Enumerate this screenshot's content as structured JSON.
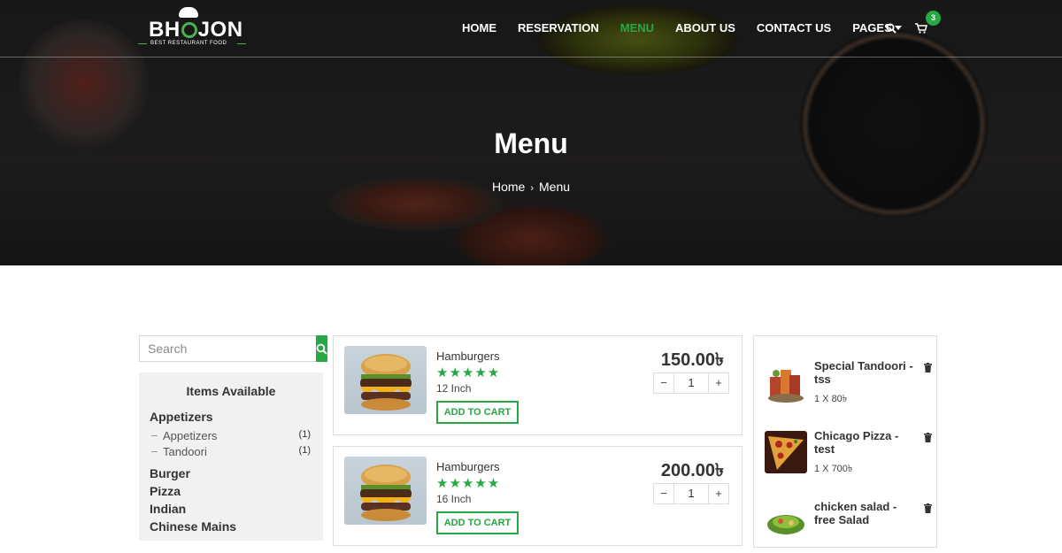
{
  "brand": {
    "name_left": "BH",
    "name_right": "JON",
    "tagline": "BEST RESTAURANT FOOD"
  },
  "nav": {
    "items": [
      {
        "label": "HOME"
      },
      {
        "label": "RESERVATION"
      },
      {
        "label": "MENU"
      },
      {
        "label": "ABOUT US"
      },
      {
        "label": "CONTACT US"
      },
      {
        "label": "PAGES"
      }
    ],
    "cart_count": "3"
  },
  "hero": {
    "title": "Menu",
    "breadcrumb": {
      "home": "Home",
      "separator": "›",
      "current": "Menu"
    }
  },
  "search": {
    "placeholder": "Search"
  },
  "categories": {
    "heading": "Items Available",
    "group_appetizers": "Appetizers",
    "sub": [
      {
        "label": "Appetizers",
        "count": "(1)"
      },
      {
        "label": "Tandoori",
        "count": "(1)"
      }
    ],
    "others": [
      {
        "label": "Burger"
      },
      {
        "label": "Pizza"
      },
      {
        "label": "Indian"
      },
      {
        "label": "Chinese Mains"
      }
    ]
  },
  "products": [
    {
      "name": "Hamburgers",
      "stars": "★★★★★",
      "rating": 5,
      "size": "12 Inch",
      "price": "150.00৳",
      "qty": "1",
      "button": "ADD TO CART"
    },
    {
      "name": "Hamburgers",
      "stars": "★★★★★",
      "rating": 5,
      "size": "16 Inch",
      "price": "200.00৳",
      "qty": "1",
      "button": "ADD TO CART"
    }
  ],
  "cart": {
    "items": [
      {
        "title": "Special Tandoori -tss",
        "meta": "1 X 80৳"
      },
      {
        "title": "Chicago Pizza - test",
        "meta": "1 X 700৳"
      },
      {
        "title": "chicken salad - free Salad",
        "meta": ""
      }
    ]
  },
  "colors": {
    "accent": "#28a745",
    "text": "#333333",
    "panel": "#f1f1f1"
  }
}
